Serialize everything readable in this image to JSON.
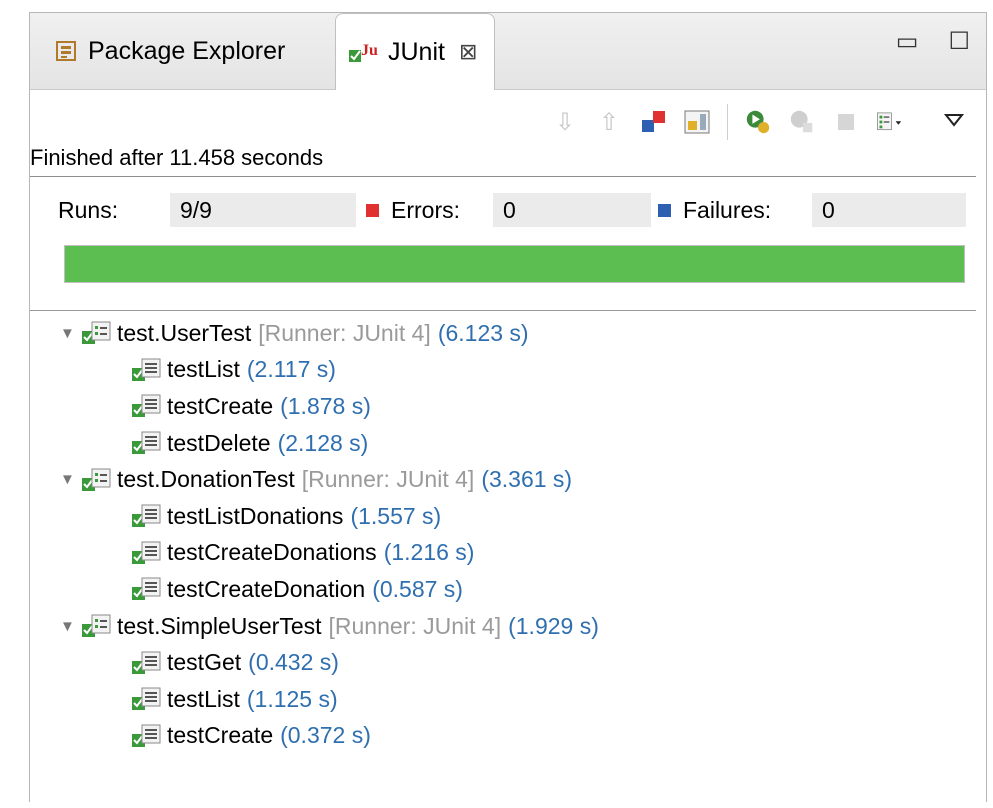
{
  "tabs": [
    {
      "label": "Package Explorer",
      "icon": "package-explorer-icon",
      "active": false
    },
    {
      "label": "JUnit",
      "icon": "junit-icon",
      "active": true
    }
  ],
  "toolbar": {
    "icons": [
      "next-failure-icon",
      "previous-failure-icon",
      "show-failures-only-icon",
      "scroll-lock-icon",
      "rerun-test-icon",
      "rerun-failed-first-icon",
      "stop-icon",
      "test-run-history-icon"
    ],
    "view_menu_icon": "view-menu-triangle-icon"
  },
  "status": "Finished after 11.458 seconds",
  "counters": {
    "runs_label": "Runs:",
    "runs_value": "9/9",
    "errors_label": "Errors:",
    "errors_value": "0",
    "failures_label": "Failures:",
    "failures_value": "0"
  },
  "progress": {
    "fraction": 1.0,
    "color": "#5cbd51"
  },
  "colors": {
    "duration": "#2f6fb0",
    "runner": "#9a9a9a",
    "error": "#e03030",
    "failure": "#2f5fb0"
  },
  "suites": [
    {
      "name": "test.UserTest",
      "runner": "[Runner: JUnit 4]",
      "time": "(6.123 s)",
      "tests": [
        {
          "name": "testList",
          "time": "(2.117 s)"
        },
        {
          "name": "testCreate",
          "time": "(1.878 s)"
        },
        {
          "name": "testDelete",
          "time": "(2.128 s)"
        }
      ]
    },
    {
      "name": "test.DonationTest",
      "runner": "[Runner: JUnit 4]",
      "time": "(3.361 s)",
      "tests": [
        {
          "name": "testListDonations",
          "time": "(1.557 s)"
        },
        {
          "name": "testCreateDonations",
          "time": "(1.216 s)"
        },
        {
          "name": "testCreateDonation",
          "time": "(0.587 s)"
        }
      ]
    },
    {
      "name": "test.SimpleUserTest",
      "runner": "[Runner: JUnit 4]",
      "time": "(1.929 s)",
      "tests": [
        {
          "name": "testGet",
          "time": "(0.432 s)"
        },
        {
          "name": "testList",
          "time": "(1.125 s)"
        },
        {
          "name": "testCreate",
          "time": "(0.372 s)"
        }
      ]
    }
  ]
}
